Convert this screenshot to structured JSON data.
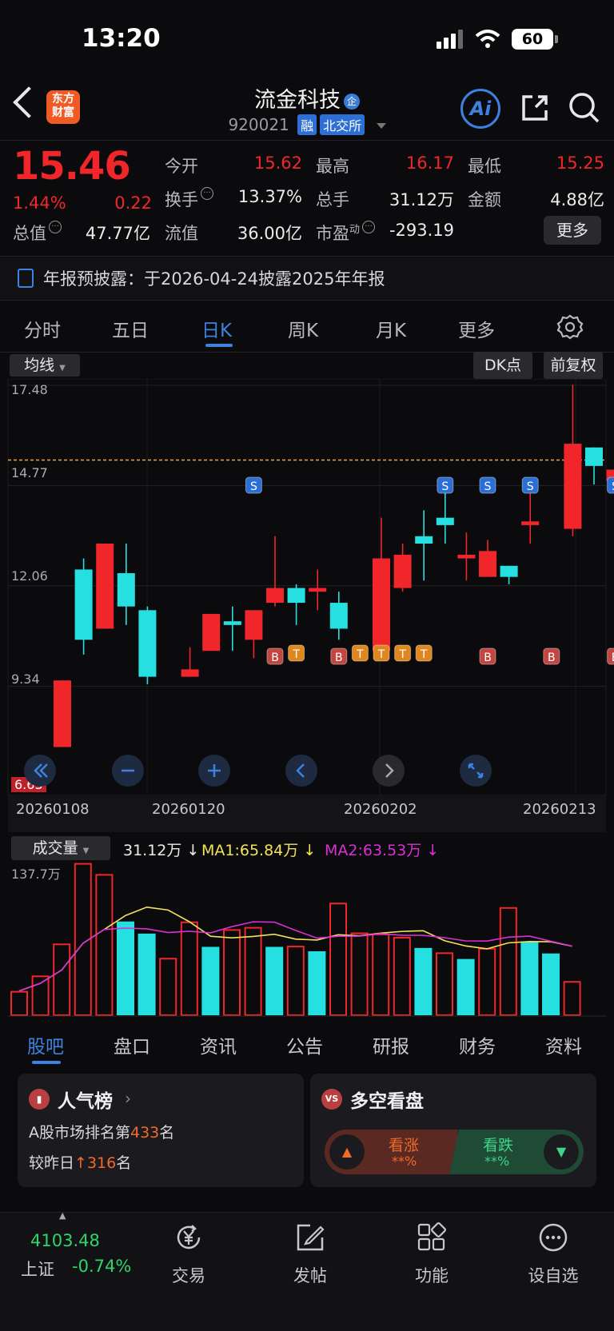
{
  "status_bar": {
    "time": "13:20",
    "battery": "60"
  },
  "header": {
    "logo_line1": "东方",
    "logo_line2": "财富",
    "stock_name": "流金科技",
    "name_badge": "企",
    "code": "920021",
    "tag1": "融",
    "tag2": "北交所",
    "ai_label": "Ai"
  },
  "quote": {
    "price": "15.46",
    "change_pct": "1.44%",
    "change": "0.22",
    "open_label": "今开",
    "open": "15.62",
    "high_label": "最高",
    "high": "16.17",
    "low_label": "最低",
    "low": "15.25",
    "turnover_label": "换手",
    "turnover": "13.37%",
    "volume_label": "总手",
    "volume": "31.12万",
    "amount_label": "金额",
    "amount": "4.88亿",
    "mcap_label": "总值",
    "mcap": "47.77亿",
    "float_label": "流值",
    "float": "36.00亿",
    "pe_label": "市盈",
    "pe_sup": "动",
    "pe": "-293.19",
    "more_label": "更多"
  },
  "notice": {
    "text": "年报预披露：于2026-04-24披露2025年年报"
  },
  "period_tabs": [
    "分时",
    "五日",
    "日K",
    "周K",
    "月K",
    "更多"
  ],
  "chart_controls": {
    "ma": "均线",
    "dk": "DK点",
    "adjust": "前复权"
  },
  "chart_data": {
    "type": "candlestick",
    "y_ticks": [
      "17.48",
      "14.77",
      "12.06",
      "9.34",
      "6.63"
    ],
    "ylim": [
      6.63,
      17.48
    ],
    "current_price_line": 15.46,
    "x_tick_labels": [
      "20260108",
      "20260120",
      "20260202",
      "20260213"
    ],
    "candles": [
      {
        "o": 9.5,
        "h": 9.5,
        "l": 7.7,
        "c": 7.7
      },
      {
        "o": 10.6,
        "h": 12.8,
        "l": 10.2,
        "c": 12.5
      },
      {
        "o": 13.2,
        "h": 13.2,
        "l": 10.9,
        "c": 10.9
      },
      {
        "o": 11.5,
        "h": 13.2,
        "l": 11.0,
        "c": 12.4
      },
      {
        "o": 9.6,
        "h": 11.5,
        "l": 9.4,
        "c": 11.4
      },
      {
        "o": 9.8,
        "h": 10.4,
        "l": 9.6,
        "c": 9.6
      },
      {
        "o": 11.3,
        "h": 11.3,
        "l": 10.3,
        "c": 10.3
      },
      {
        "o": 11.0,
        "h": 11.5,
        "l": 10.3,
        "c": 11.1
      },
      {
        "o": 11.4,
        "h": 11.4,
        "l": 10.1,
        "c": 10.6
      },
      {
        "o": 12.0,
        "h": 13.4,
        "l": 11.5,
        "c": 11.6
      },
      {
        "o": 11.6,
        "h": 12.1,
        "l": 11.0,
        "c": 12.0
      },
      {
        "o": 12.0,
        "h": 12.5,
        "l": 11.4,
        "c": 11.9
      },
      {
        "o": 10.9,
        "h": 11.9,
        "l": 10.6,
        "c": 11.6
      },
      {
        "o": 12.8,
        "h": 13.9,
        "l": 10.3,
        "c": 10.3
      },
      {
        "o": 12.9,
        "h": 13.2,
        "l": 11.9,
        "c": 12.0
      },
      {
        "o": 13.2,
        "h": 14.1,
        "l": 12.2,
        "c": 13.4
      },
      {
        "o": 13.7,
        "h": 14.7,
        "l": 13.2,
        "c": 13.9
      },
      {
        "o": 12.9,
        "h": 13.5,
        "l": 12.2,
        "c": 12.8
      },
      {
        "o": 13.0,
        "h": 13.3,
        "l": 12.3,
        "c": 12.3
      },
      {
        "o": 12.3,
        "h": 12.6,
        "l": 12.1,
        "c": 12.6
      },
      {
        "o": 13.8,
        "h": 14.6,
        "l": 13.2,
        "c": 13.7
      },
      {
        "o": 15.9,
        "h": 17.5,
        "l": 13.4,
        "c": 13.6
      },
      {
        "o": 15.3,
        "h": 15.8,
        "l": 14.8,
        "c": 15.8
      },
      {
        "o": 15.2,
        "h": 15.7,
        "l": 14.4,
        "c": 14.9
      },
      {
        "o": 15.4,
        "h": 15.8,
        "l": 15.25,
        "c": 15.46
      }
    ],
    "markers": [
      {
        "i": 9,
        "label": "S"
      },
      {
        "i": 18,
        "label": "S"
      },
      {
        "i": 20,
        "label": "S"
      },
      {
        "i": 22,
        "label": "S"
      },
      {
        "i": 26,
        "label": "S"
      },
      {
        "i": 10,
        "label": "B"
      },
      {
        "i": 13,
        "label": "B"
      },
      {
        "i": 20,
        "label": "B"
      },
      {
        "i": 23,
        "label": "B"
      },
      {
        "i": 26,
        "label": "B"
      },
      {
        "i": 11,
        "label": "T"
      },
      {
        "i": 14,
        "label": "T"
      },
      {
        "i": 15,
        "label": "T"
      },
      {
        "i": 16,
        "label": "T"
      },
      {
        "i": 17,
        "label": "T"
      },
      {
        "i": 27,
        "label": "T"
      }
    ]
  },
  "volume": {
    "label": "成交量",
    "current": "31.12万",
    "ma1": "MA1:65.84万",
    "ma2": "MA2:63.53万",
    "max_label": "137.7万",
    "values": [
      22,
      36,
      65,
      138,
      128,
      85,
      74,
      52,
      85,
      62,
      78,
      80,
      62,
      63,
      58,
      102,
      75,
      74,
      71,
      61,
      57,
      51,
      61,
      98,
      67,
      56,
      31
    ],
    "down": [
      false,
      false,
      false,
      false,
      false,
      true,
      true,
      false,
      false,
      true,
      false,
      false,
      true,
      false,
      true,
      false,
      false,
      false,
      false,
      true,
      false,
      true,
      false,
      false,
      true,
      true,
      false
    ]
  },
  "bottom_tabs": [
    "股吧",
    "盘口",
    "资讯",
    "公告",
    "研报",
    "财务",
    "资料"
  ],
  "cards": {
    "popularity_title": "人气榜",
    "rank_prefix": "A股市场排名第",
    "rank": "433",
    "rank_suffix": "名",
    "vs_prefix": "较昨日",
    "vs_value": "316",
    "vs_suffix": "名",
    "sentiment_title": "多空看盘",
    "bull_label": "看涨",
    "bull_pct": "**%",
    "bear_label": "看跌",
    "bear_pct": "**%"
  },
  "bottom_nav": {
    "index_value": "4103.48",
    "index_name": "上证",
    "index_change": "-0.74%",
    "items": [
      "交易",
      "发帖",
      "功能",
      "设自选"
    ]
  },
  "colors": {
    "up": "#f0262a",
    "down": "#26dfe0",
    "accent": "#3d82e0",
    "ma1": "#f3e25a",
    "ma2": "#d92fd6"
  }
}
